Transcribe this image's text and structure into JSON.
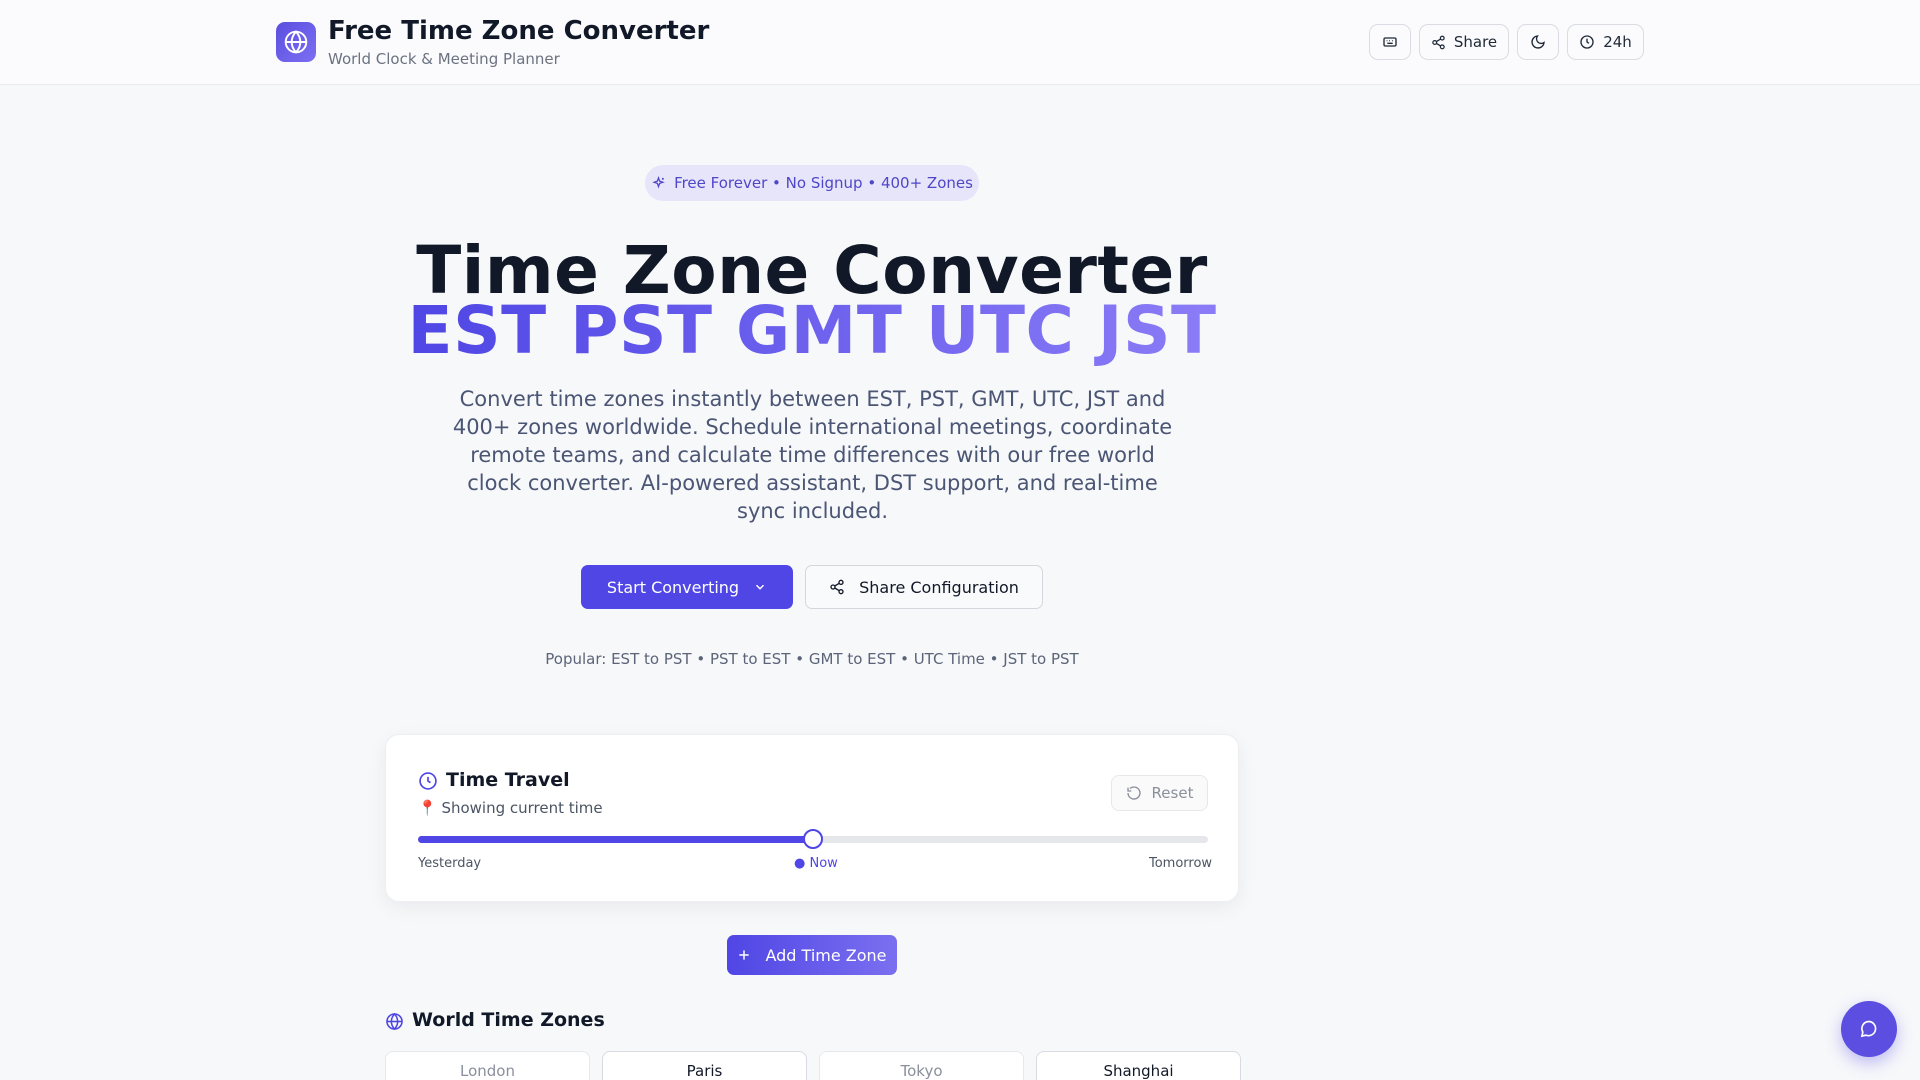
{
  "header": {
    "title": "Free Time Zone Converter",
    "subtitle": "World Clock & Meeting Planner",
    "share_label": "Share",
    "format_label": "24h"
  },
  "hero": {
    "badge": "Free Forever • No Signup • 400+ Zones",
    "title": "Time Zone Converter",
    "zones_line": "EST PST GMT UTC JST",
    "description": "Convert time zones instantly between EST, PST, GMT, UTC, JST and 400+ zones worldwide. Schedule international meetings, coordinate remote teams, and calculate time differences with our free world clock converter. AI-powered assistant, DST support, and real-time sync included.",
    "primary_button": "Start Converting",
    "secondary_button": "Share Configuration",
    "popular": "Popular: EST to PST • PST to EST • GMT to EST • UTC Time • JST to PST"
  },
  "time_travel": {
    "title": "Time Travel",
    "status": "📍 Showing current time",
    "reset_label": "Reset",
    "slider_fraction": 0.5,
    "label_start": "Yesterday",
    "label_now": "● Now",
    "label_end": "Tomorrow"
  },
  "add_zone_label": "Add Time Zone",
  "world": {
    "title": "World Time Zones",
    "zones": [
      "London",
      "Paris",
      "Tokyo",
      "Shanghai"
    ]
  },
  "colors": {
    "accent": "#4f46e5",
    "accent_light": "#8b7cf6"
  }
}
